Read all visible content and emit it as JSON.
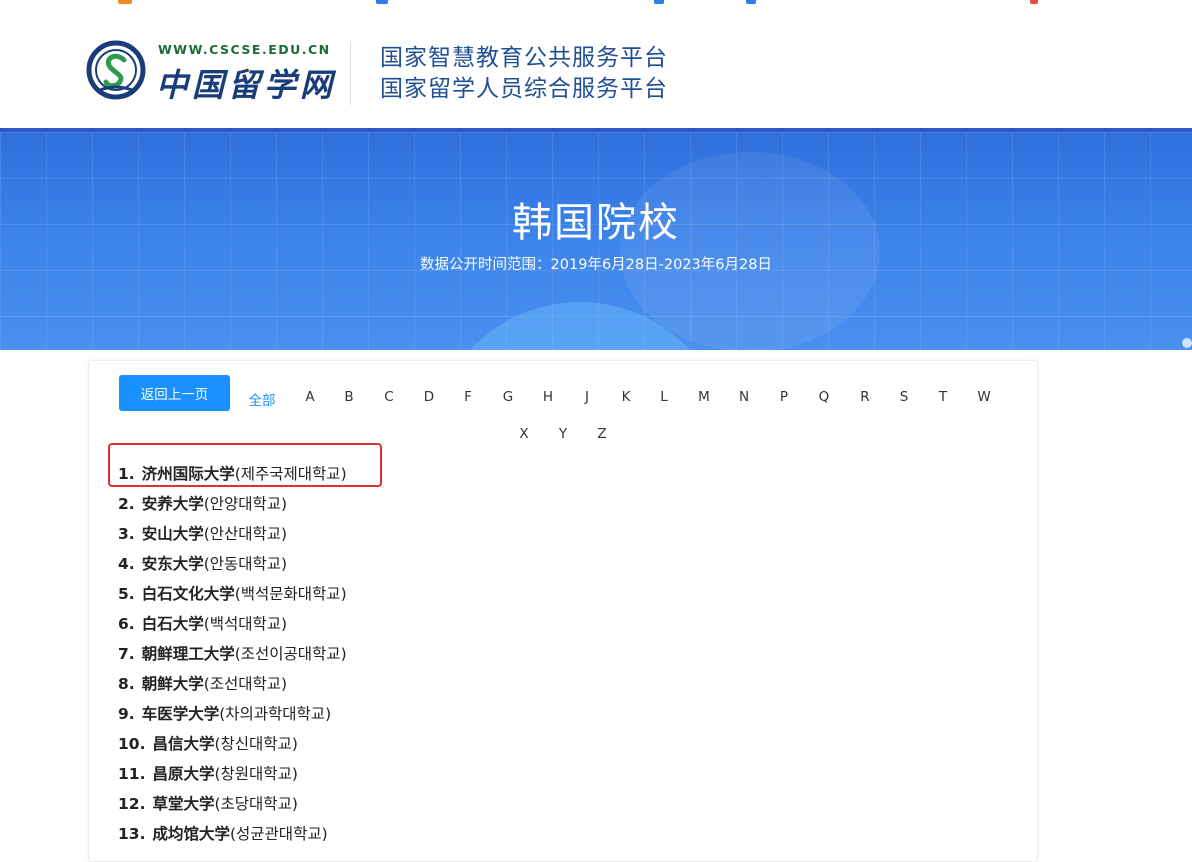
{
  "header": {
    "logo_url_text": "WWW.CSCSE.EDU.CN",
    "logo_cn_text": "中国留学网",
    "platform_line_1": "国家智慧教育公共服务平台",
    "platform_line_2": "国家留学人员综合服务平台"
  },
  "banner": {
    "title": "韩国院校",
    "subtitle": "数据公开时间范围：2019年6月28日-2023年6月28日"
  },
  "filters": {
    "back_label": "返回上一页",
    "all_label": "全部",
    "letters": [
      "A",
      "B",
      "C",
      "D",
      "F",
      "G",
      "H",
      "J",
      "K",
      "L",
      "M",
      "N",
      "P",
      "Q",
      "R",
      "S",
      "T",
      "W",
      "X",
      "Y",
      "Z"
    ]
  },
  "universities": [
    {
      "num": "1.",
      "cn": "济州国际大学",
      "kr": "(제주국제대학교)"
    },
    {
      "num": "2.",
      "cn": "安养大学",
      "kr": "(안양대학교)"
    },
    {
      "num": "3.",
      "cn": "安山大学",
      "kr": "(안산대학교)"
    },
    {
      "num": "4.",
      "cn": "安东大学",
      "kr": "(안동대학교)"
    },
    {
      "num": "5.",
      "cn": "白石文化大学",
      "kr": "(백석문화대학교)"
    },
    {
      "num": "6.",
      "cn": "白石大学",
      "kr": "(백석대학교)"
    },
    {
      "num": "7.",
      "cn": "朝鲜理工大学",
      "kr": "(조선이공대학교)"
    },
    {
      "num": "8.",
      "cn": "朝鲜大学",
      "kr": "(조선대학교)"
    },
    {
      "num": "9.",
      "cn": "车医学大学",
      "kr": "(차의과학대학교)"
    },
    {
      "num": "10.",
      "cn": "昌信大学",
      "kr": "(창신대학교)"
    },
    {
      "num": "11.",
      "cn": "昌原大学",
      "kr": "(창원대학교)"
    },
    {
      "num": "12.",
      "cn": "草堂大学",
      "kr": "(초당대학교)"
    },
    {
      "num": "13.",
      "cn": "成均馆大学",
      "kr": "(성균관대학교)"
    }
  ],
  "colors": {
    "accent": "#1890ff",
    "brand_blue": "#1f4f94",
    "highlight_red": "#e03131"
  }
}
